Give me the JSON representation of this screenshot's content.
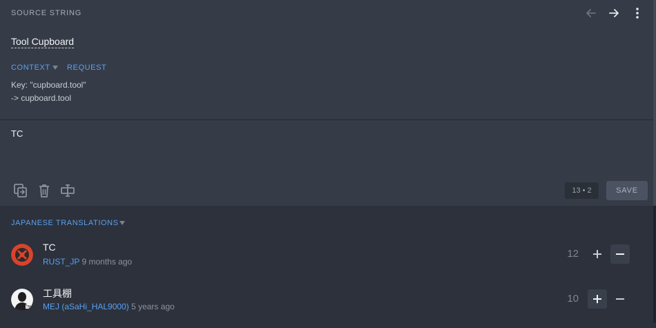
{
  "source": {
    "header_label": "SOURCE STRING",
    "text": "Tool Cupboard",
    "tabs": [
      {
        "label": "CONTEXT"
      },
      {
        "label": "REQUEST"
      }
    ],
    "context_lines": [
      "Key: \"cupboard.tool\"",
      "-> cupboard.tool"
    ],
    "icons": {
      "back": "arrow-left-icon",
      "forward": "arrow-right-icon",
      "menu": "more-vertical-icon"
    }
  },
  "editor": {
    "value": "TC",
    "counter": "13 • 2",
    "save_label": "SAVE",
    "tools": [
      "copy-icon",
      "trash-icon",
      "text-cursor-icon"
    ]
  },
  "translations": {
    "header_label": "JAPANESE TRANSLATIONS",
    "items": [
      {
        "text": "TC",
        "user": "RUST_JP",
        "time": "9 months ago",
        "votes": "12",
        "active_vote": "down"
      },
      {
        "text": "工具棚",
        "user": "MEJ (aSaHi_HAL9000)",
        "time": "5 years ago",
        "votes": "10",
        "active_vote": "up"
      }
    ]
  },
  "colors": {
    "accent": "#5aa0f0",
    "panel": "#363c47",
    "background": "#2c313b"
  }
}
